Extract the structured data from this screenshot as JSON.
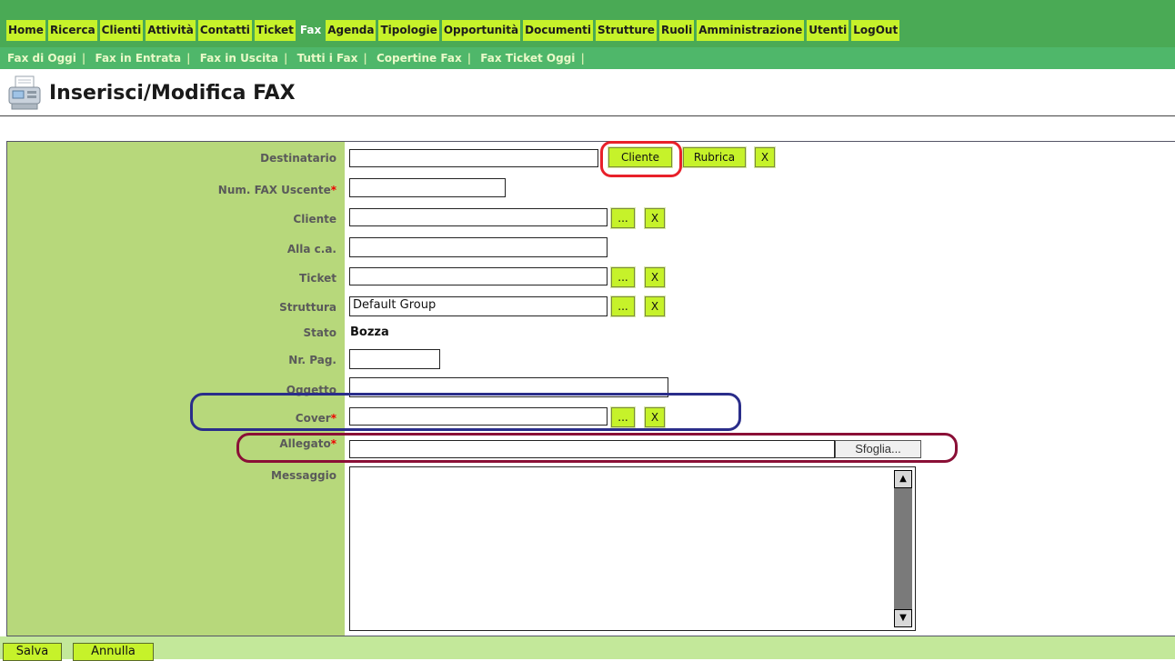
{
  "nav": {
    "items": [
      "Home",
      "Ricerca",
      "Clienti",
      "Attività",
      "Contatti",
      "Ticket",
      "Fax",
      "Agenda",
      "Tipologie",
      "Opportunità",
      "Documenti",
      "Strutture",
      "Ruoli",
      "Amministrazione",
      "Utenti",
      "LogOut"
    ],
    "active": "Fax"
  },
  "subnav": {
    "items": [
      "Fax di Oggi",
      "Fax in Entrata",
      "Fax in Uscita",
      "Tutti i Fax",
      "Copertine Fax",
      "Fax Ticket Oggi"
    ]
  },
  "page": {
    "title": "Inserisci/Modifica FAX"
  },
  "form": {
    "destinatario": {
      "label": "Destinatario",
      "value": ""
    },
    "num_fax": {
      "label": "Num. FAX Uscente",
      "value": ""
    },
    "cliente": {
      "label": "Cliente",
      "value": ""
    },
    "alla_ca": {
      "label": "Alla c.a.",
      "value": ""
    },
    "ticket": {
      "label": "Ticket",
      "value": ""
    },
    "struttura": {
      "label": "Struttura",
      "value": "Default Group"
    },
    "stato": {
      "label": "Stato",
      "value": "Bozza"
    },
    "nr_pag": {
      "label": "Nr. Pag.",
      "value": ""
    },
    "oggetto": {
      "label": "Oggetto",
      "value": ""
    },
    "cover": {
      "label": "Cover",
      "value": ""
    },
    "allegato": {
      "label": "Allegato",
      "value": ""
    },
    "messaggio": {
      "label": "Messaggio",
      "value": ""
    },
    "required_mark": "*",
    "buttons": {
      "cliente": "Cliente",
      "rubrica": "Rubrica",
      "clear": "X",
      "browse": "...",
      "sfoglia": "Sfoglia..."
    }
  },
  "footer": {
    "save": "Salva",
    "cancel": "Annulla"
  },
  "colors": {
    "nav_bg": "#4aaa55",
    "menu_button": "#c6f22a",
    "label_column": "#b7d87b",
    "annotation_red": "#e8202a",
    "annotation_blue": "#2a2d8a",
    "annotation_maroon": "#8a0f36"
  }
}
